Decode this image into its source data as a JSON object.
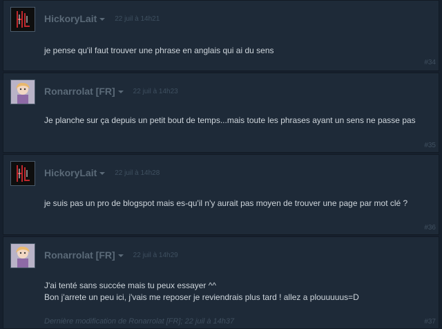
{
  "posts": [
    {
      "author": "HickoryLait",
      "timestamp": "22 juil à 14h21",
      "text": "je pense qu'il faut trouver une phrase en anglais qui ai du sens",
      "number": "#34",
      "avatar_icon": "hickorylait-avatar"
    },
    {
      "author": "Ronarrolat [FR]",
      "timestamp": "22 juil à 14h23",
      "text": "Je planche sur ça depuis un petit bout de temps...mais toute les phrases ayant un sens ne passe pas",
      "number": "#35",
      "avatar_icon": "ronarrolat-avatar"
    },
    {
      "author": "HickoryLait",
      "timestamp": "22 juil à 14h28",
      "text": "je suis pas un pro de blogspot mais es-qu'il n'y aurait pas moyen de trouver une page par mot clé ?",
      "number": "#36",
      "avatar_icon": "hickorylait-avatar"
    },
    {
      "author": "Ronarrolat [FR]",
      "timestamp": "22 juil à 14h29",
      "text_line1": "J'ai tenté sans succée mais tu peux essayer ^^",
      "text_line2": "Bon j'arrete un peu ici, j'vais me reposer je reviendrais plus tard ! allez a plouuuuus=D",
      "edit_note": "Dernière modification de Ronarrolat [FR]; 22 juil à 14h37",
      "number": "#37",
      "avatar_icon": "ronarrolat-avatar"
    }
  ],
  "colors": {
    "background": "#16202d",
    "post_bg": "#1e2a38",
    "author": "#5b6a78",
    "text": "#cfd6dc",
    "muted": "#405060"
  }
}
